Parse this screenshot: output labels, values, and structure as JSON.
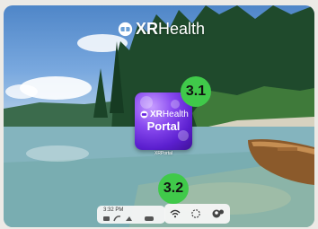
{
  "brand": {
    "prefix": "XR",
    "suffix": "Health"
  },
  "app_tile": {
    "brand_prefix": "XR",
    "brand_suffix": "Health",
    "title": "Portal",
    "caption": "XRPortal"
  },
  "badges": {
    "app_badge": "3.1",
    "taskbar_badge": "3.2"
  },
  "taskbar": {
    "time": "3:32 PM",
    "left_icons": [
      "app-icon",
      "app-icon",
      "app-icon",
      "headset-icon"
    ],
    "right_icons": [
      "wifi-icon",
      "loading-icon",
      "avatar-icon"
    ]
  },
  "colors": {
    "badge_green": "#40c94a",
    "tile_purple": "#6a26e0",
    "taskbar_bg": "#f5f5f5"
  }
}
